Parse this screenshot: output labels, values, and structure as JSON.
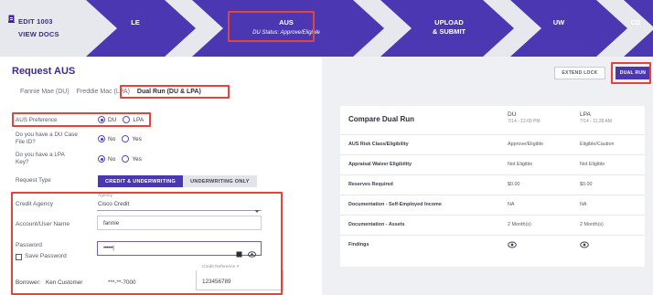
{
  "left_links": {
    "edit": "EDIT 1003",
    "view_docs": "VIEW DOCS"
  },
  "stages": [
    {
      "label": "LE",
      "sub": ""
    },
    {
      "label": "AUS",
      "sub": "DU Status: Approve/Eligible"
    },
    {
      "label": "UPLOAD",
      "label2": "& SUBMIT",
      "sub": ""
    },
    {
      "label": "UW",
      "sub": ""
    },
    {
      "label": "CD",
      "sub": ""
    }
  ],
  "page": {
    "title": "Request AUS",
    "tabs": [
      "Fannie Mae (DU)",
      "Freddie Mac (LPA)",
      "Dual Run (DU & LPA)"
    ]
  },
  "form": {
    "aus_preference": {
      "label": "AUS Preference",
      "opt1": "DU",
      "opt2": "LPA",
      "selected": "DU"
    },
    "du_case": {
      "label_line1": "Do you have a DU Case",
      "label_line2": "File ID?",
      "opt1": "No",
      "opt2": "Yes",
      "selected": "No"
    },
    "lpa_key": {
      "label_line1": "Do you have a LPA",
      "label_line2": "Key?",
      "opt1": "No",
      "opt2": "Yes",
      "selected": "No"
    },
    "request_type": {
      "label": "Request Type",
      "opt1": "CREDIT & UNDERWRITING",
      "opt2": "UNDERWRITING ONLY",
      "selected": "CREDIT & UNDERWRITING"
    },
    "credit_agency": {
      "label": "Credit Agency",
      "field_label": "Agency",
      "value": "Cisco Credit"
    },
    "account": {
      "label": "Account/User Name",
      "value": "fannie"
    },
    "password": {
      "label": "Password",
      "value": "••••••|"
    },
    "save_password": {
      "label": "Save Password"
    },
    "borrower": {
      "label": "Borrower:",
      "name": "Ken Customer",
      "ssn": "***-**-7000",
      "ref_label": "Credit Reference #",
      "ref_value": "123456789"
    }
  },
  "actions": {
    "extend_lock": "EXTEND LOCK",
    "dual_run": "DUAL RUN"
  },
  "compare": {
    "title": "Compare Dual Run",
    "columns": [
      {
        "name": "DU",
        "date": "7/14 - 12:09 PM"
      },
      {
        "name": "LPA",
        "date": "7/14 - 11:28 AM"
      }
    ],
    "rows": [
      {
        "label": "AUS Risk Class/Eligibility",
        "du": "Approve/Eligible",
        "lpa": "Eligible/Caution"
      },
      {
        "label": "Appraisal Waiver Eligibility",
        "du": "Not Eligible",
        "lpa": "Not Eligible"
      },
      {
        "label": "Reserves Required",
        "du": "$0.00",
        "lpa": "$0.00"
      },
      {
        "label": "Documentation - Self-Employed Income",
        "du": "NA",
        "lpa": "NA"
      },
      {
        "label": "Documentation - Assets",
        "du": "2 Month(s)",
        "lpa": "2 Month(s)"
      },
      {
        "label": "Findings",
        "du_icon": "eye-icon",
        "lpa_icon": "eye-icon"
      }
    ]
  },
  "colors": {
    "brand": "#4b37b2",
    "highlight": "#e0443a",
    "topbar_dark": "#3d2a8c"
  }
}
